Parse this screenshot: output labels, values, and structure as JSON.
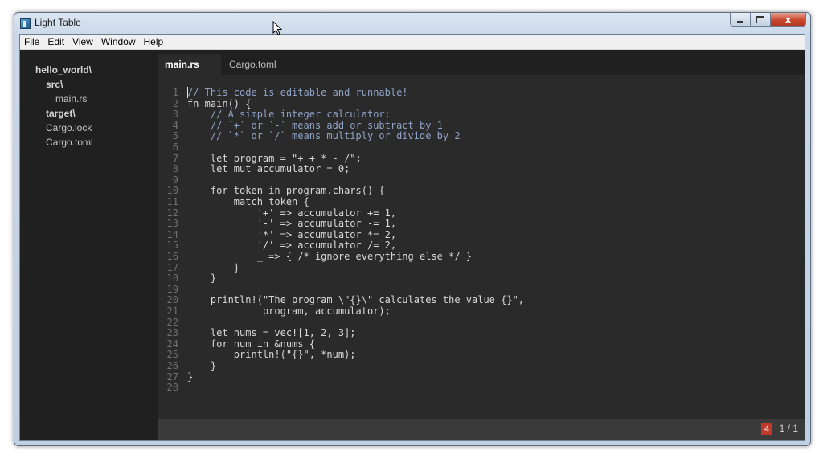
{
  "window": {
    "title": "Light Table",
    "caption_close": "x",
    "icon": "light-table-icon"
  },
  "menu": [
    "File",
    "Edit",
    "View",
    "Window",
    "Help"
  ],
  "sidebar": {
    "items": [
      {
        "label": "hello_world\\",
        "kind": "folder",
        "depth": 0
      },
      {
        "label": "src\\",
        "kind": "folder",
        "depth": 1
      },
      {
        "label": "main.rs",
        "kind": "file",
        "depth": 2
      },
      {
        "label": "target\\",
        "kind": "folder",
        "depth": 1
      },
      {
        "label": "Cargo.lock",
        "kind": "file",
        "depth": 1
      },
      {
        "label": "Cargo.toml",
        "kind": "file",
        "depth": 1
      }
    ]
  },
  "tabs": [
    {
      "label": "main.rs",
      "active": true
    },
    {
      "label": "Cargo.toml",
      "active": false
    }
  ],
  "code": {
    "lines": [
      "// This code is editable and runnable!",
      "fn main() {",
      "    // A simple integer calculator:",
      "    // `+` or `-` means add or subtract by 1",
      "    // `*` or `/` means multiply or divide by 2",
      "",
      "    let program = \"+ + * - /\";",
      "    let mut accumulator = 0;",
      "",
      "    for token in program.chars() {",
      "        match token {",
      "            '+' => accumulator += 1,",
      "            '-' => accumulator -= 1,",
      "            '*' => accumulator *= 2,",
      "            '/' => accumulator /= 2,",
      "            _ => { /* ignore everything else */ }",
      "        }",
      "    }",
      "",
      "    println!(\"The program \\\"{}\\\" calculates the value {}\",",
      "             program, accumulator);",
      "",
      "    let nums = vec![1, 2, 3];",
      "    for num in &nums {",
      "        println!(\"{}\", *num);",
      "    }",
      "}",
      ""
    ]
  },
  "status": {
    "error_count": "4",
    "position": "1 / 1"
  },
  "colors": {
    "editor_bg": "#2a2a2a",
    "sidebar_bg": "#202020",
    "comment": "#90a3c7",
    "keyword": "#8fbfe0",
    "error_badge": "#c0392b"
  }
}
